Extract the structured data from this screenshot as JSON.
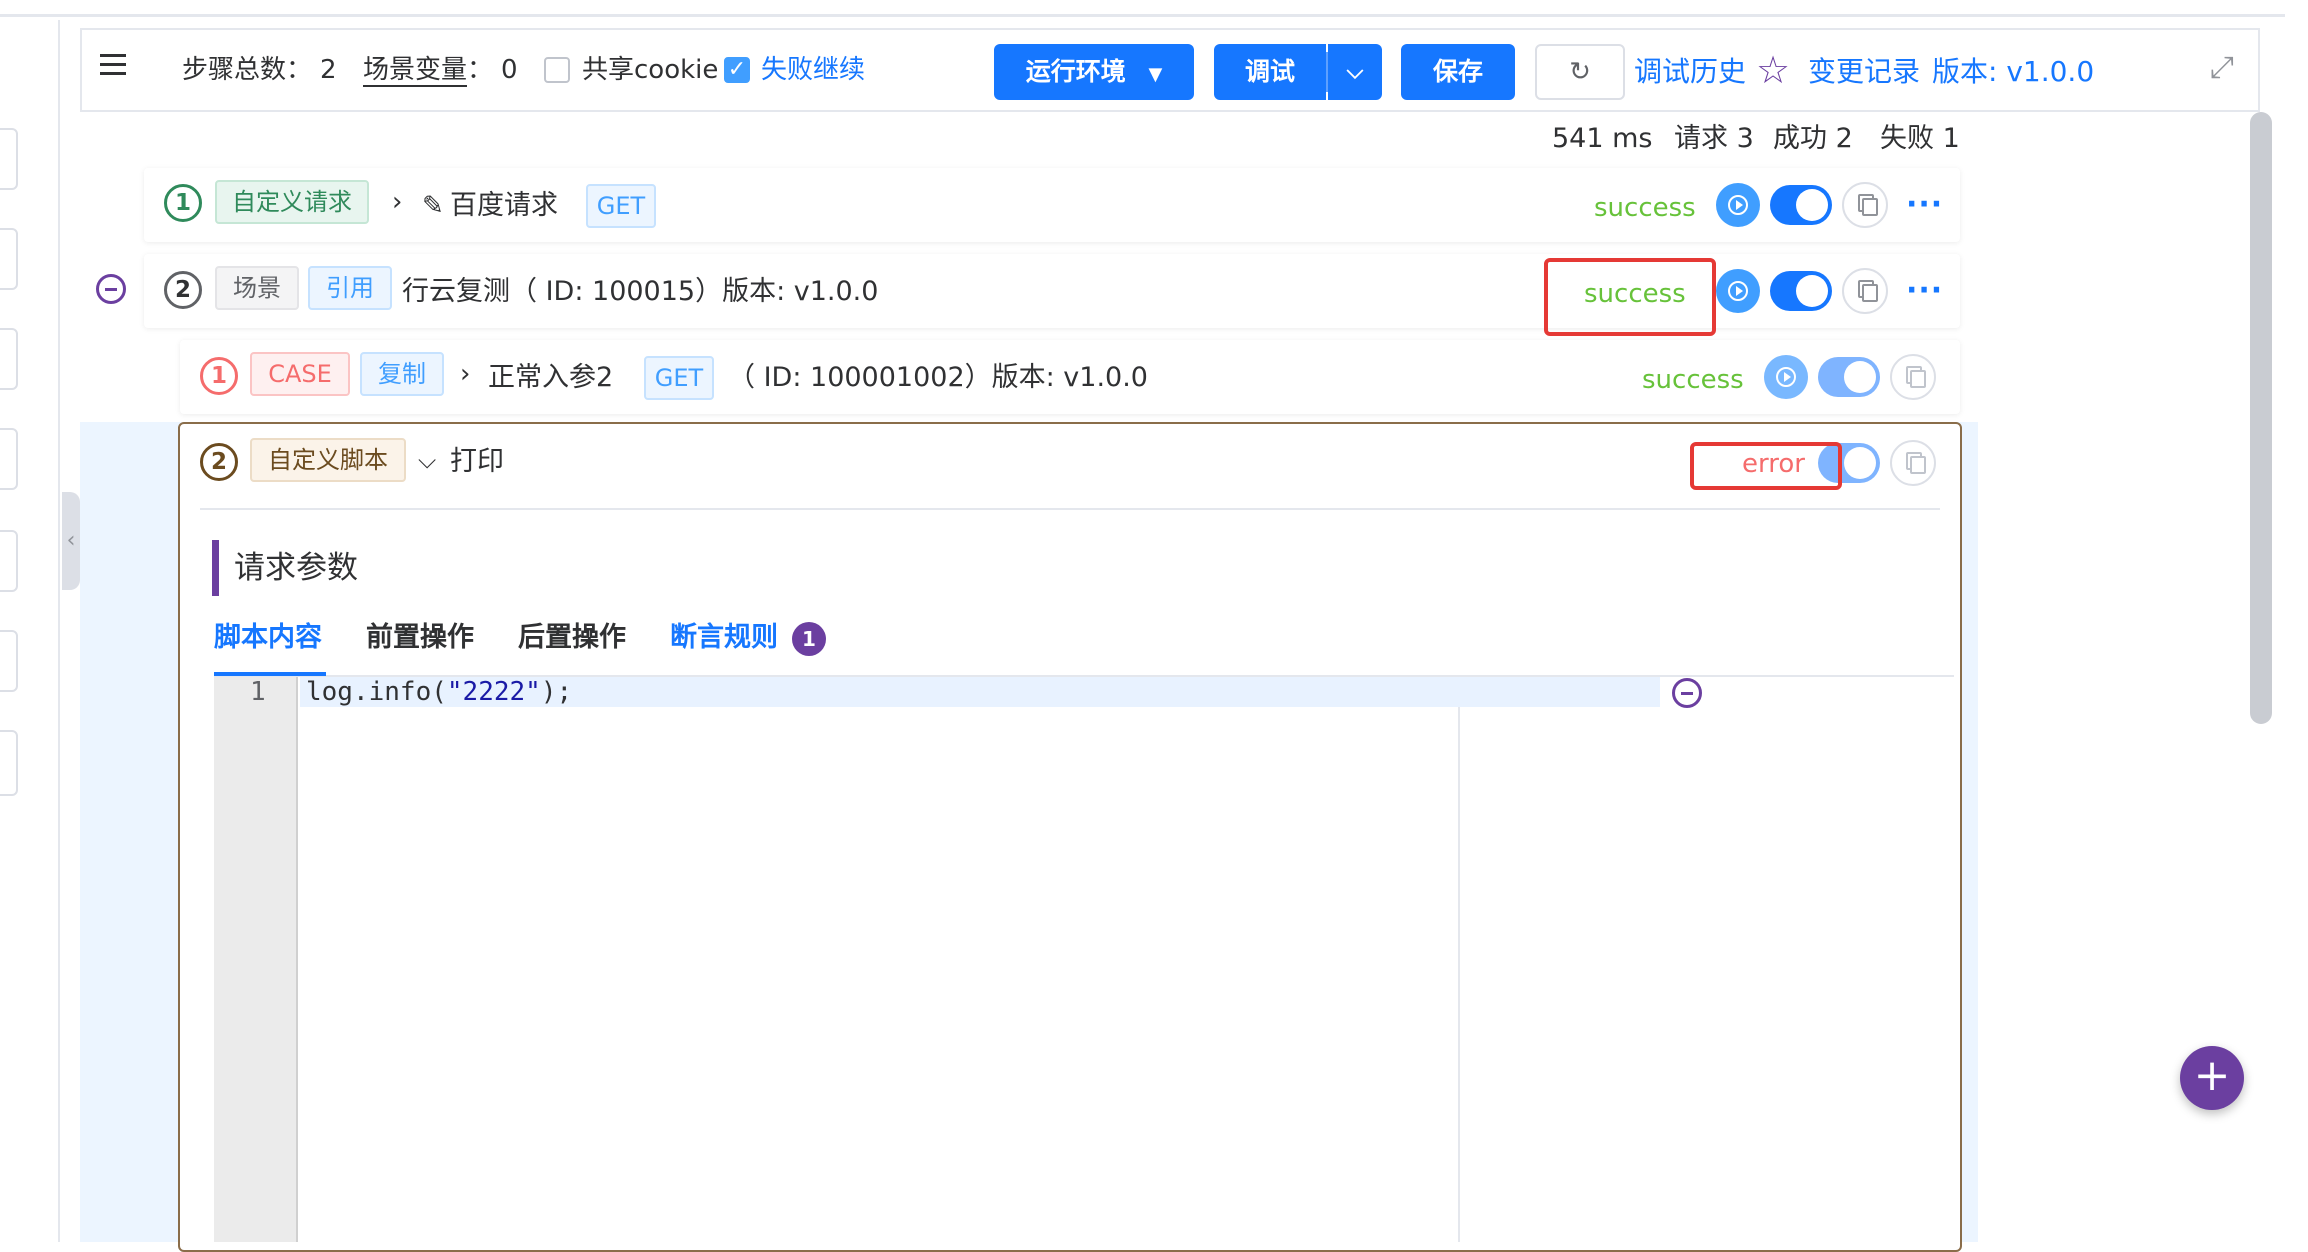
{
  "toolbar": {
    "steps_label": "步骤总数",
    "steps_colon": "：",
    "steps_count": "2",
    "vars_label": "场景变量",
    "vars_colon": "：",
    "vars_count": "0",
    "share_cookie": "共享cookie",
    "share_cookie_checked": false,
    "fail_continue": "失败继续",
    "fail_continue_checked": true,
    "run_env": "运行环境",
    "debug": "调试",
    "save": "保存",
    "debug_history": "调试历史",
    "change_log": "变更记录",
    "version": "版本: v1.0.0"
  },
  "stats": {
    "duration": "541 ms",
    "requests": "请求 3",
    "success": "成功 2",
    "fail": "失败 1"
  },
  "steps": [
    {
      "index": "1",
      "type": "自定义请求",
      "name": "百度请求",
      "method": "GET",
      "status": "success"
    },
    {
      "index": "2",
      "type": "场景",
      "ref": "引用",
      "name": "行云复测（ ID: 100015）版本: v1.0.0",
      "status": "success",
      "children": [
        {
          "index": "1",
          "type": "CASE",
          "copy": "复制",
          "name": "正常入参2",
          "method": "GET",
          "detail": "（ ID: 100001002）版本: v1.0.0",
          "status": "success"
        },
        {
          "index": "2",
          "type": "自定义脚本",
          "name": "打印",
          "status": "error"
        }
      ]
    }
  ],
  "script_panel": {
    "section_title": "请求参数",
    "tabs": [
      "脚本内容",
      "前置操作",
      "后置操作",
      "断言规则"
    ],
    "assert_badge": "1",
    "line_number": "1",
    "code_prefix": "log.info(",
    "code_string": "\"2222\"",
    "code_suffix": ");"
  },
  "colors": {
    "primary": "#1677ff",
    "success": "#67c23a",
    "error": "#f56c6c",
    "accent": "#6b3fa0"
  }
}
